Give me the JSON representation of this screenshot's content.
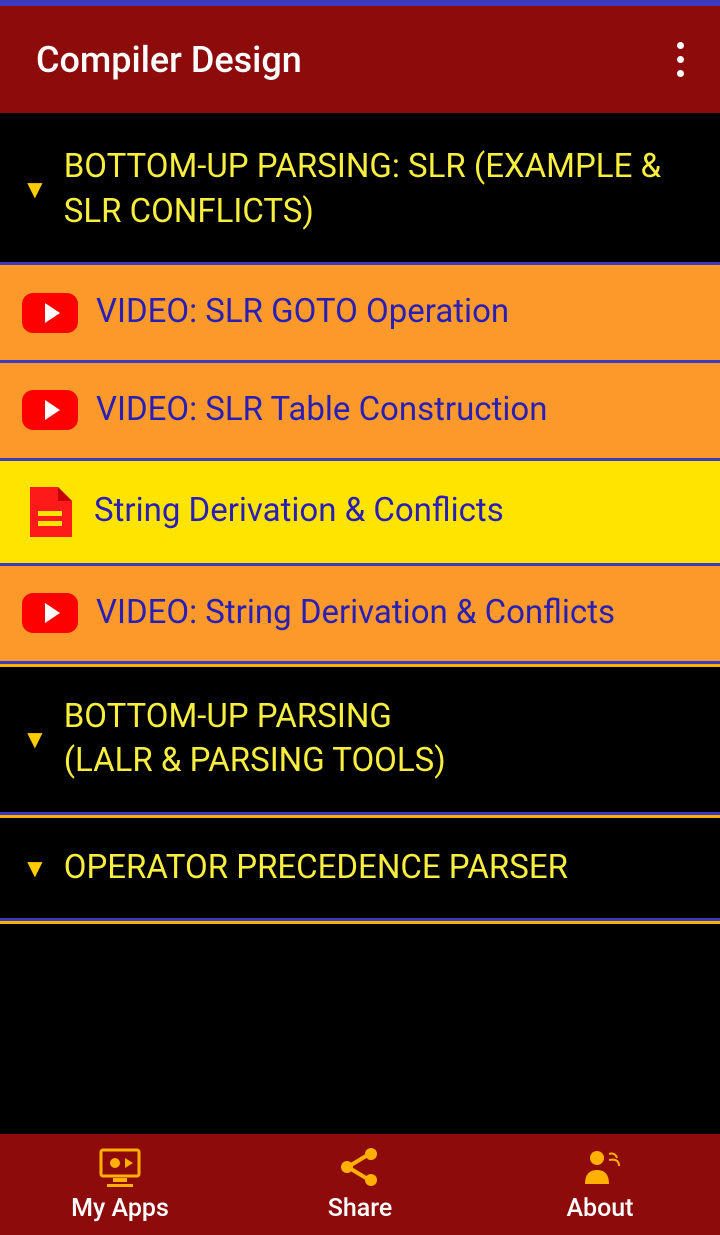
{
  "appBar": {
    "title": "Compiler Design"
  },
  "sections": [
    {
      "type": "header",
      "text": "BOTTOM-UP PARSING: SLR (EXAMPLE & SLR CONFLICTS)"
    },
    {
      "type": "video",
      "text": "VIDEO: SLR GOTO Operation"
    },
    {
      "type": "video",
      "text": "VIDEO: SLR Table Construction"
    },
    {
      "type": "doc",
      "text": "String Derivation & Conflicts"
    },
    {
      "type": "video",
      "text": "VIDEO: String Derivation & Conflicts"
    },
    {
      "type": "header",
      "text": "BOTTOM-UP PARSING\n(LALR & PARSING TOOLS)"
    },
    {
      "type": "header",
      "text": "OPERATOR PRECEDENCE PARSER"
    }
  ],
  "bottomNav": {
    "myApps": "My Apps",
    "share": "Share",
    "about": "About"
  }
}
